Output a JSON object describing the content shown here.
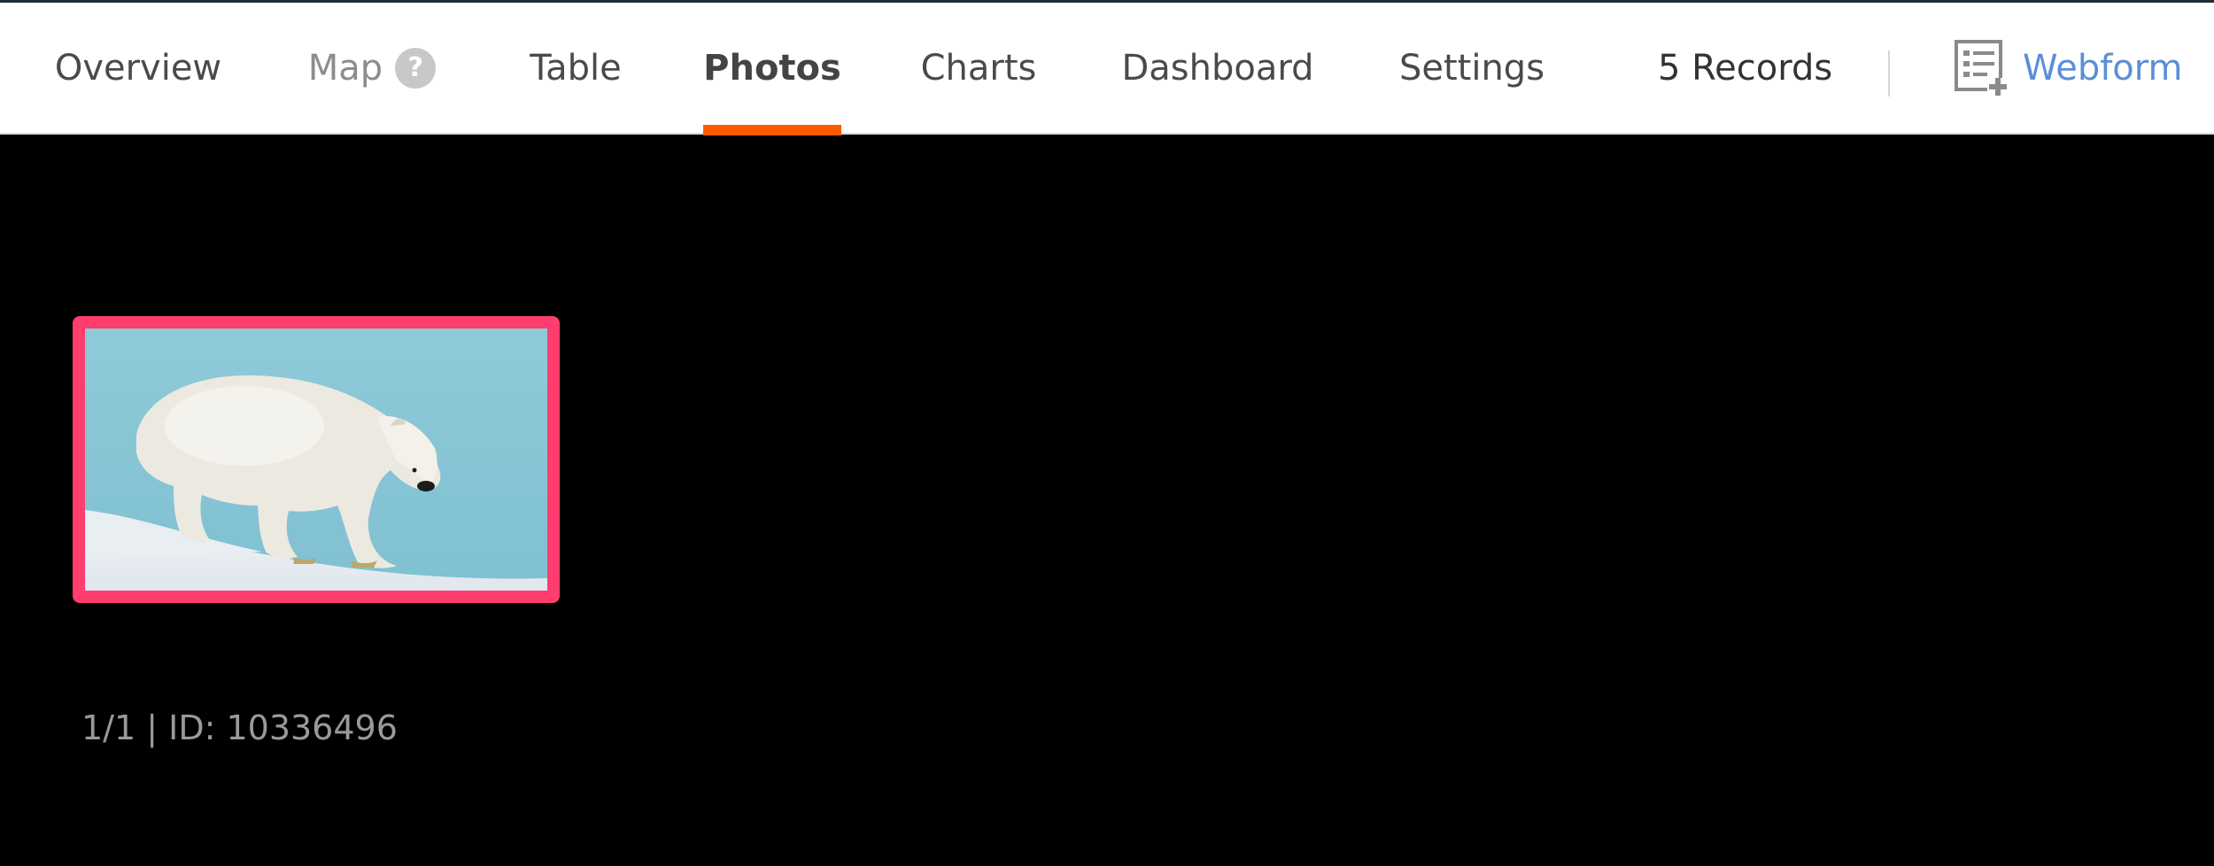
{
  "nav": {
    "tabs": [
      {
        "label": "Overview"
      },
      {
        "label": "Map",
        "help_badge": "?"
      },
      {
        "label": "Table"
      },
      {
        "label": "Photos",
        "active": true
      },
      {
        "label": "Charts"
      },
      {
        "label": "Dashboard"
      },
      {
        "label": "Settings"
      }
    ],
    "records": "5 Records",
    "webform": {
      "label": "Webform",
      "icon": "form-add-icon"
    }
  },
  "gallery": {
    "photos": [
      {
        "subject": "polar bear on snow",
        "selected": true
      }
    ],
    "caption": "1/1 | ID: 10336496"
  },
  "colors": {
    "accent": "#ff5a00",
    "selection_border": "#ff3d6e",
    "link": "#5b8fd6",
    "background": "#000000"
  }
}
